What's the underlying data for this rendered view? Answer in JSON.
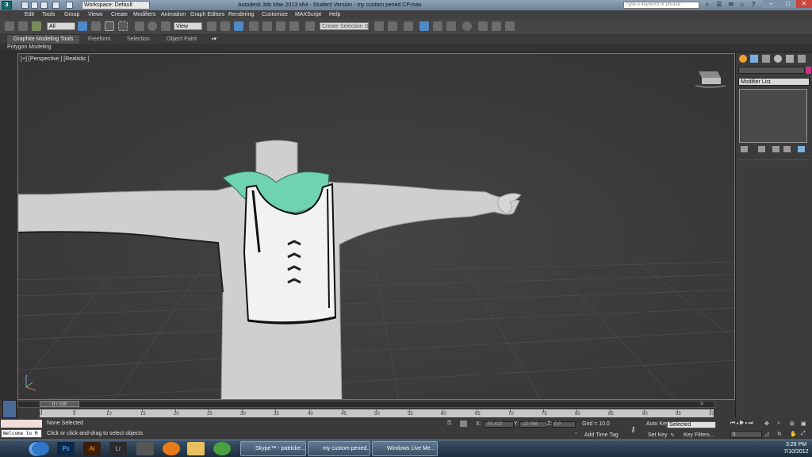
{
  "window": {
    "title": "Autodesk 3ds Max  2013 x64  -  Student Version  -  my custom pened CP.max",
    "workspace_label": "Workspace: Default",
    "search_placeholder": "Type a keyword or phrase",
    "app_logo": "3",
    "titlebar_accent": "#8fa3b8"
  },
  "menu": [
    "Edit",
    "Tools",
    "Group",
    "Views",
    "Create",
    "Modifiers",
    "Animation",
    "Graph Editors",
    "Rendering",
    "Customize",
    "MAXScript",
    "Help"
  ],
  "toolbar": {
    "selection_filter": "All",
    "reference_coord": "View",
    "named_selection_set": "Create Selection Se"
  },
  "ribbon": {
    "tabs": [
      "Graphite Modeling Tools",
      "Freeform",
      "Selection",
      "Object Paint"
    ],
    "panel_label": "Polygon Modeling"
  },
  "viewport": {
    "label": "[+] [Perspective ] [Realistic ]",
    "background": "#3b3b3b",
    "model_accent": "#6fd2b0"
  },
  "command_panel": {
    "modifier_list": "Modifier List",
    "color_swatch": "#d0308c"
  },
  "timeline": {
    "current": "0 / 100",
    "progress": 0.0,
    "ticks": [
      "0",
      "5",
      "10",
      "15",
      "20",
      "25",
      "30",
      "35",
      "40",
      "45",
      "50",
      "55",
      "60",
      "65",
      "70",
      "75",
      "80",
      "85",
      "90",
      "95",
      "100"
    ]
  },
  "status": {
    "listener_output": "Welcome to M",
    "selection": "None Selected",
    "prompt": "Click or click-and-drag to select objects",
    "x_label": "X:",
    "x_value": "-55.422",
    "y_label": "Y:",
    "y_value": "-22.586",
    "z_label": "Z:",
    "z_value": "0.0",
    "grid": "Grid = 10.0",
    "add_time_tag": "Add Time Tag",
    "auto_key": "Auto Key",
    "set_key": "Set Key",
    "key_mode": "Selected",
    "key_filters": "Key Filters...",
    "frame": "0"
  },
  "taskbar": {
    "tasks": [
      "Skype™ - patricke...",
      "my custom pened...",
      "Windows Live Me..."
    ],
    "time": "3:28 PM",
    "date": "7/10/2012"
  }
}
